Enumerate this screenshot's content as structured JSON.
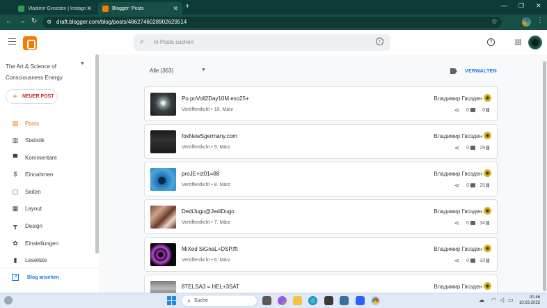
{
  "browser": {
    "tabs": [
      {
        "title": "Vladimir Gvozden | Instagram,",
        "favicon_color": "#2e9d4f"
      },
      {
        "title": "Blogger: Posts",
        "favicon_color": "#f57c00"
      }
    ],
    "new_tab": "+",
    "window_controls": {
      "minimize": "—",
      "maximize": "❐",
      "close": "✕"
    },
    "url": "draft.blogger.com/blog/posts/4862746028902629514",
    "nav": {
      "back": "←",
      "forward": "→",
      "reload": "↻"
    }
  },
  "header": {
    "search_placeholder": "In Posts suchen",
    "help": "?",
    "info": "i"
  },
  "sidebar": {
    "blog_title": "The Art & Science of Consciousness Energy",
    "new_post": "NEUER POST",
    "items": [
      {
        "label": "Posts",
        "icon": "posts-icon",
        "glyph": "▤",
        "active": true
      },
      {
        "label": "Statistik",
        "icon": "stats-icon",
        "glyph": "▥",
        "active": false
      },
      {
        "label": "Kommentare",
        "icon": "comments-icon",
        "glyph": "▀",
        "active": false
      },
      {
        "label": "Einnahmen",
        "icon": "earnings-icon",
        "glyph": "$",
        "active": false
      },
      {
        "label": "Seiten",
        "icon": "pages-icon",
        "glyph": "▢",
        "active": false
      },
      {
        "label": "Layout",
        "icon": "layout-icon",
        "glyph": "▦",
        "active": false
      },
      {
        "label": "Design",
        "icon": "design-icon",
        "glyph": "┳",
        "active": false
      },
      {
        "label": "Einstellungen",
        "icon": "settings-icon",
        "glyph": "✿",
        "active": false
      },
      {
        "label": "Leseliste",
        "icon": "reading-list-icon",
        "glyph": "▮",
        "active": false
      }
    ],
    "view_blog": "Blog ansehen"
  },
  "main": {
    "filter": "Alle (363)",
    "manage": "VERWALTEN",
    "posts": [
      {
        "title": "Po.poVoll2Day10M.exo25+",
        "status": "Veröffentlicht",
        "date": "10. März",
        "author": "Владимир Гвозден",
        "comments": "0",
        "views": "0",
        "thumb": "radial-gradient(circle at 50% 45%, #e8f0f0 8%, #8a9a9c 18%, #3a3f42 45%, #1a1c1e 100%)"
      },
      {
        "title": "foxNewSgermany.com",
        "status": "Veröffentlicht",
        "date": "9. März",
        "author": "Владимир Гвозден",
        "comments": "0",
        "views": "29",
        "thumb": "linear-gradient(180deg, #1a1a1a 0%, #333 40%, #1a1a1a 100%)"
      },
      {
        "title": "proJE+ct01=88",
        "status": "Veröffentlicht",
        "date": "8. März",
        "author": "Владимир Гвозден",
        "comments": "0",
        "views": "25",
        "thumb": "radial-gradient(circle at 45% 55%, #0a2a4a 18%, #1f6fb0 22%, #4aa6de 60%, #2a7ab8 100%)"
      },
      {
        "title": "DediJugo@JediDugo",
        "status": "Veröffentlicht",
        "date": "7. März",
        "author": "Владимир Гвозден",
        "comments": "0",
        "views": "34",
        "thumb": "linear-gradient(135deg, #8a4b3a 0%, #c9a38a 30%, #6b3a2a 55%, #e8d8c8 75%, #4a2a1e 100%)"
      },
      {
        "title": "MiXed SiGnaL+DSP.fft",
        "status": "Veröffentlicht",
        "date": "6. März",
        "author": "Владимир Гвозден",
        "comments": "0",
        "views": "33",
        "thumb": "radial-gradient(circle at 40% 50%, #0a0a0a 12%, #b03bd0 18%, #2a0a30 30%, #c24adf 40%, #0a0a0a 60%)"
      },
      {
        "title": "8TELSA3 = HEL+3SAT",
        "status": "",
        "date": "",
        "author": "Владимир Гвозден",
        "comments": "",
        "views": "",
        "thumb": "linear-gradient(180deg, #7a7a7a 0%, #bdbdbd 50%, #5a5a5a 100%)"
      }
    ]
  },
  "taskbar": {
    "search": "Suche",
    "time": "00:46",
    "date": "10.03.2025"
  }
}
